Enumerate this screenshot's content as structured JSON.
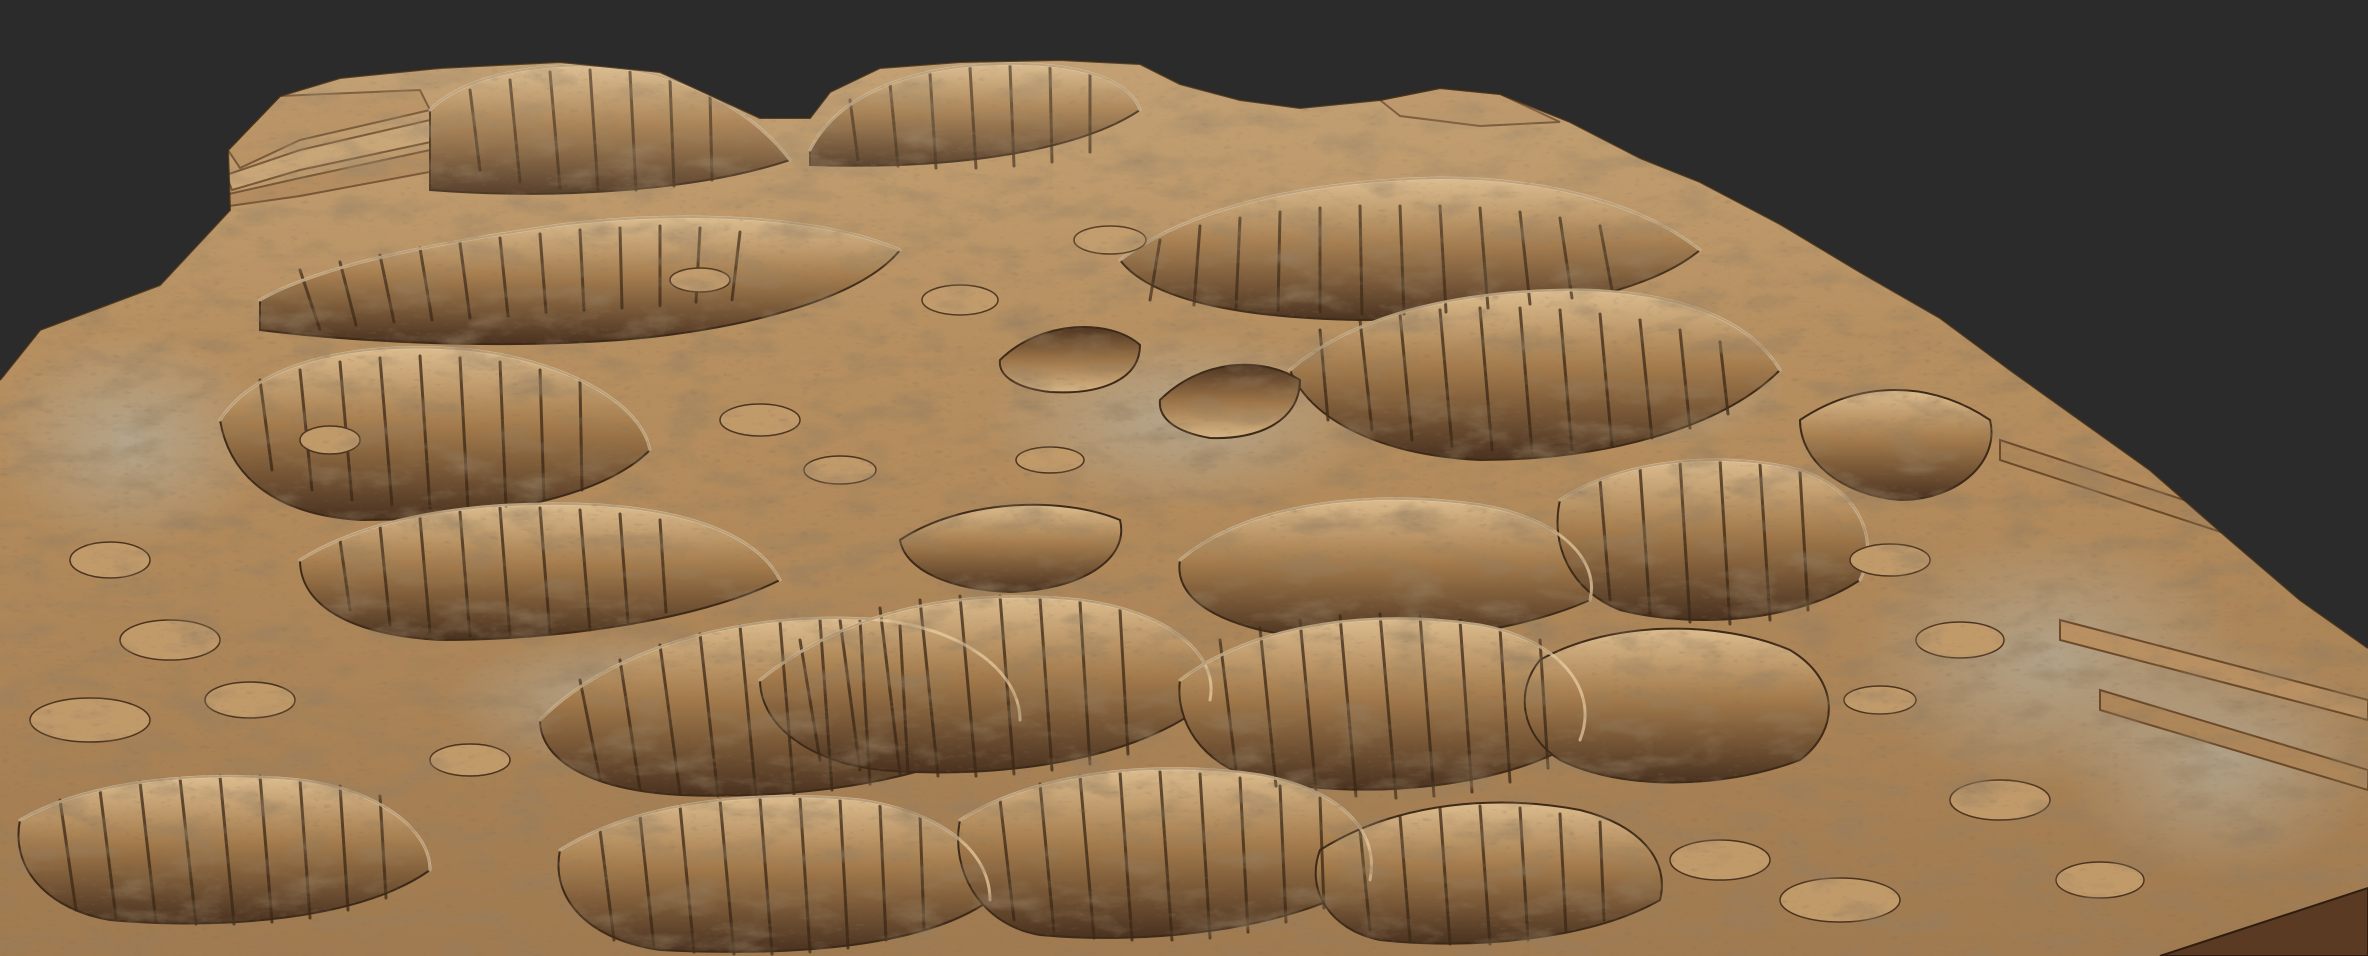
{
  "scene": {
    "kind": "3d-terrain-render",
    "background_color": "#2b2b2c",
    "terrain_colors": {
      "sand_light": "#c9a273",
      "sand_mid": "#b48b5d",
      "rock_dark": "#5e4128",
      "shadow": "#3a2816",
      "highlight": "#e3c69c",
      "dust_gray": "#a8a08e"
    }
  }
}
